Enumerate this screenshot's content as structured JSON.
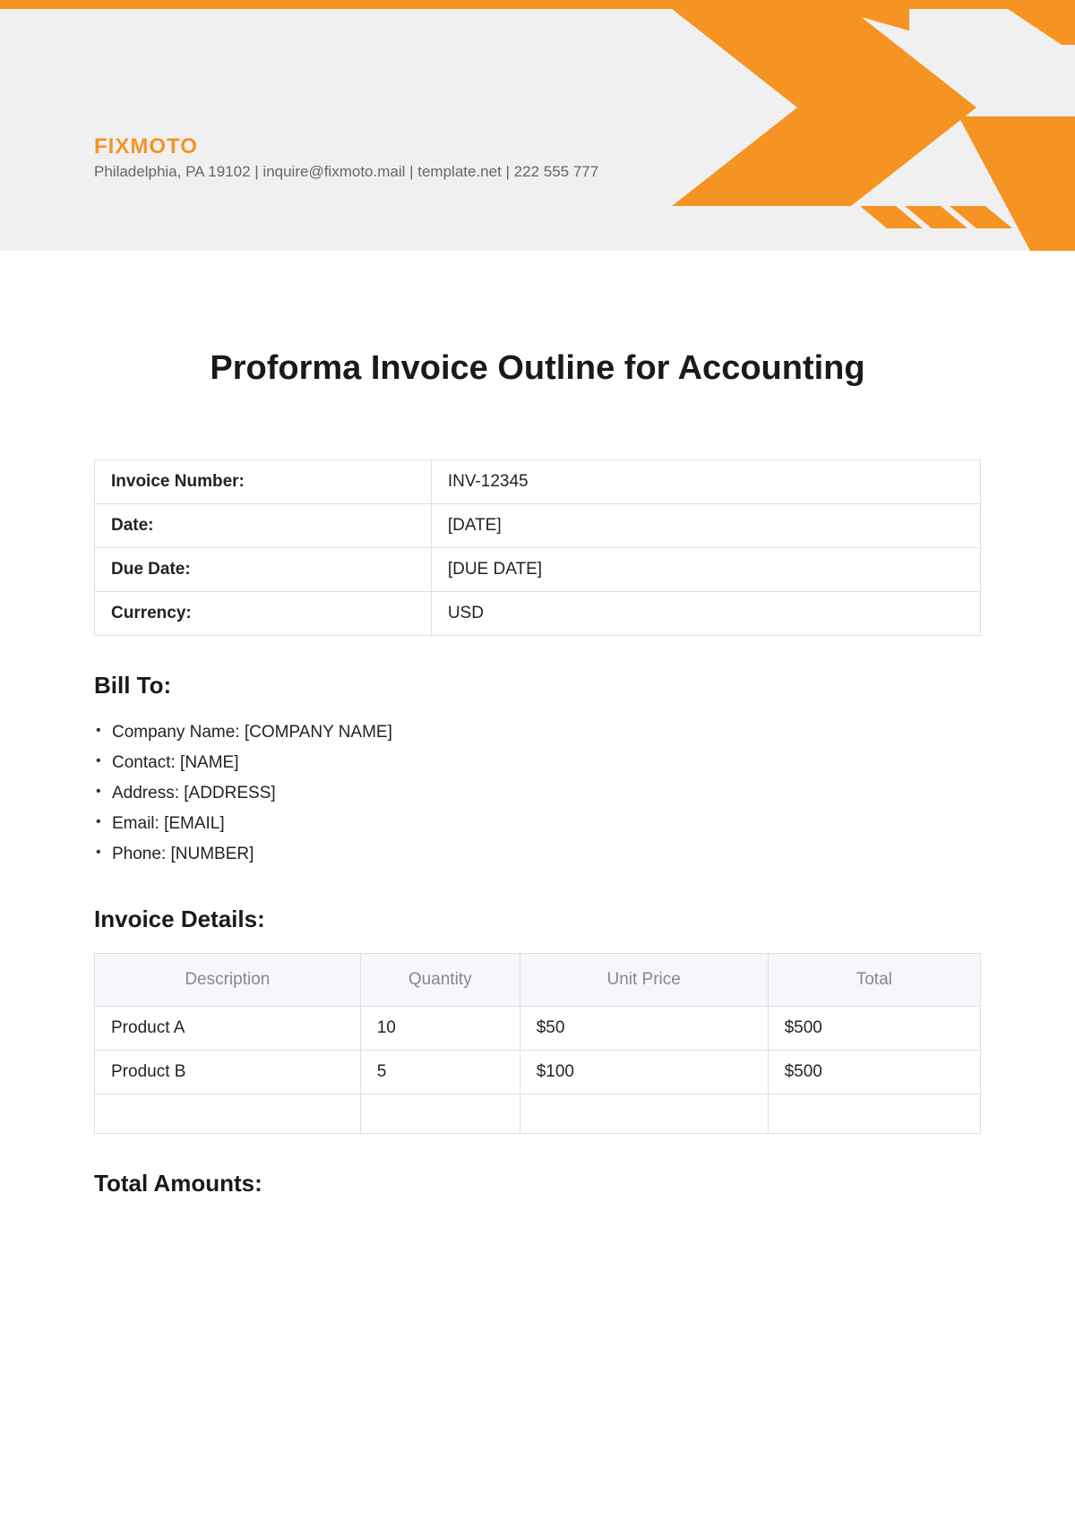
{
  "company": {
    "name": "FIXMOTO",
    "contact": "Philadelphia, PA 19102 | inquire@fixmoto.mail | template.net | 222 555 777"
  },
  "title": "Proforma Invoice Outline for Accounting",
  "info": {
    "label_invoice_number": "Invoice Number:",
    "invoice_number": "INV-12345",
    "label_date": "Date:",
    "date": "[DATE]",
    "label_due_date": "Due Date:",
    "due_date": "[DUE DATE]",
    "label_currency": "Currency:",
    "currency": "USD"
  },
  "bill_to": {
    "heading": "Bill To:",
    "company_name": "Company Name: [COMPANY NAME]",
    "contact": "Contact: [NAME]",
    "address": "Address: [ADDRESS]",
    "email": "Email: [EMAIL]",
    "phone": "Phone: [NUMBER]"
  },
  "invoice_details": {
    "heading": "Invoice Details:",
    "headers": {
      "description": "Description",
      "quantity": "Quantity",
      "unit_price": "Unit Price",
      "total": "Total"
    },
    "rows": [
      {
        "description": "Product A",
        "quantity": "10",
        "unit_price": "$50",
        "total": "$500"
      },
      {
        "description": "Product B",
        "quantity": "5",
        "unit_price": "$100",
        "total": "$500"
      }
    ]
  },
  "total_amounts": {
    "heading": "Total Amounts:"
  }
}
